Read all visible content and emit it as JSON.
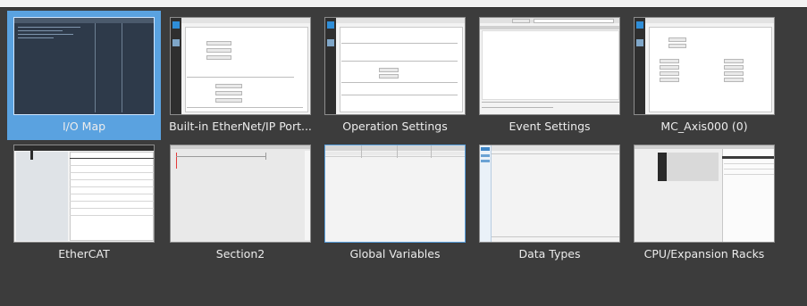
{
  "tiles": [
    {
      "id": "io_map",
      "label": "I/O Map",
      "selected": true
    },
    {
      "id": "ethernet_port",
      "label": "Built-in EtherNet/IP Port..."
    },
    {
      "id": "operation_settings",
      "label": "Operation Settings"
    },
    {
      "id": "event_settings",
      "label": "Event Settings"
    },
    {
      "id": "mc_axis",
      "label": "MC_Axis000 (0)"
    },
    {
      "id": "ethercat",
      "label": "EtherCAT"
    },
    {
      "id": "section2",
      "label": "Section2"
    },
    {
      "id": "global_variables",
      "label": "Global Variables"
    },
    {
      "id": "data_types",
      "label": "Data Types"
    },
    {
      "id": "cpu_racks",
      "label": "CPU/Expansion Racks"
    }
  ],
  "colors": {
    "background": "#3c3c3c",
    "selected": "#5aa2e0",
    "label_text": "#ececec"
  }
}
